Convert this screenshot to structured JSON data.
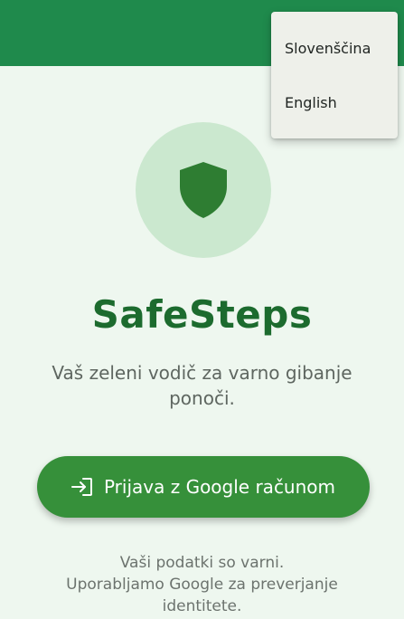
{
  "language_menu": {
    "items": [
      {
        "label": "Slovenščina"
      },
      {
        "label": "English"
      }
    ]
  },
  "hero": {
    "icon": "shield-icon"
  },
  "app": {
    "title": "SafeSteps",
    "tagline": "Vaš zeleni vodič za varno gibanje ponoči."
  },
  "login_button": {
    "icon": "login-icon",
    "label": "Prijava z Google računom"
  },
  "footer": {
    "line1": "Vaši podatki so varni.",
    "line2": "Uporabljamo Google za preverjanje identitete."
  },
  "colors": {
    "app_bar": "#1f8a4c",
    "background": "#eef7ef",
    "accent": "#36903a",
    "title": "#1c6b2e",
    "hero_circle": "#cbe8cf",
    "shield": "#2e7d32"
  }
}
